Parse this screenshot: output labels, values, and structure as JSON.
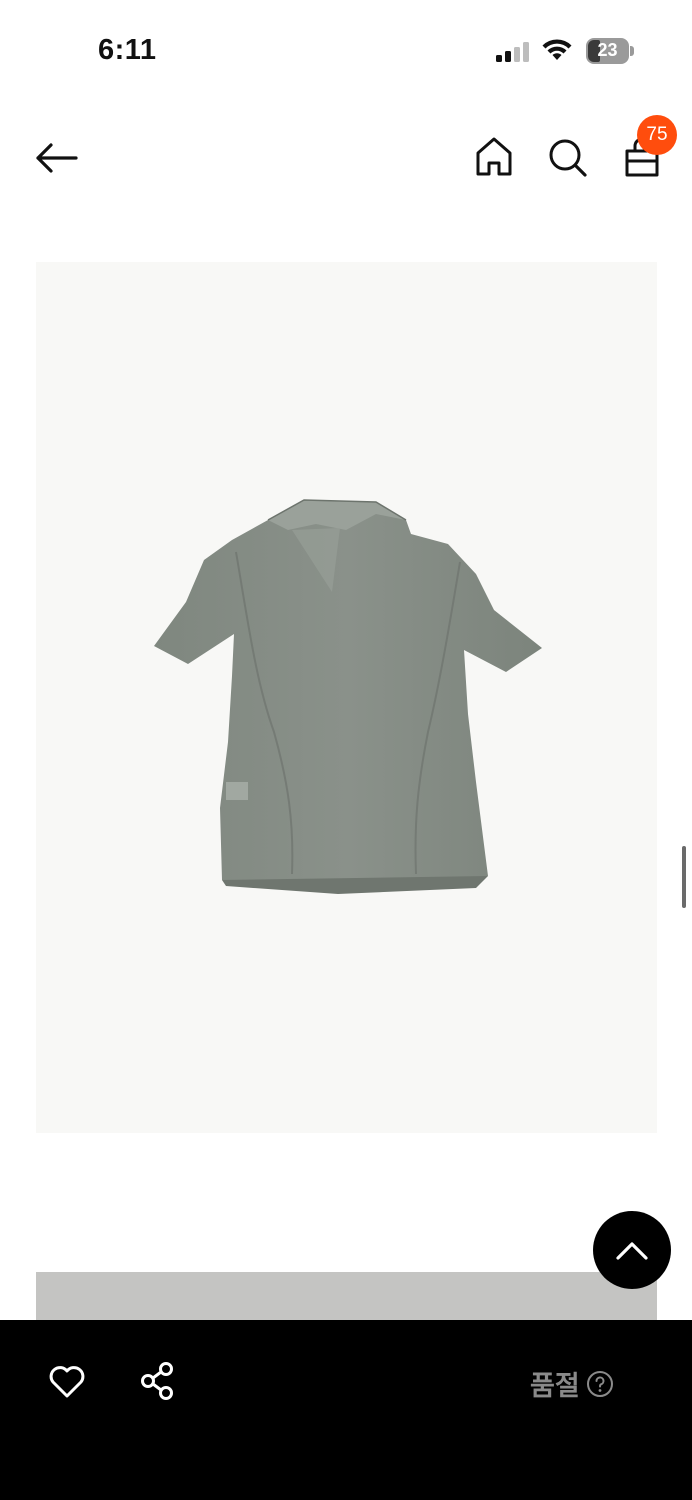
{
  "status_bar": {
    "time": "6:11",
    "battery": "23"
  },
  "header": {
    "cart_badge": "75"
  },
  "bottom_bar": {
    "soldout_label": "품절"
  },
  "icons": [
    "arrow-left-icon",
    "home-icon",
    "search-icon",
    "shopping-bag-icon",
    "chevron-up-icon",
    "heart-icon",
    "share-icon",
    "question-circle-icon"
  ],
  "colors": {
    "badge": "#ff4d0d",
    "bottom_bar": "#000000",
    "soldout_text": "#8a8a8a",
    "image_bg": "#f8f8f6"
  }
}
